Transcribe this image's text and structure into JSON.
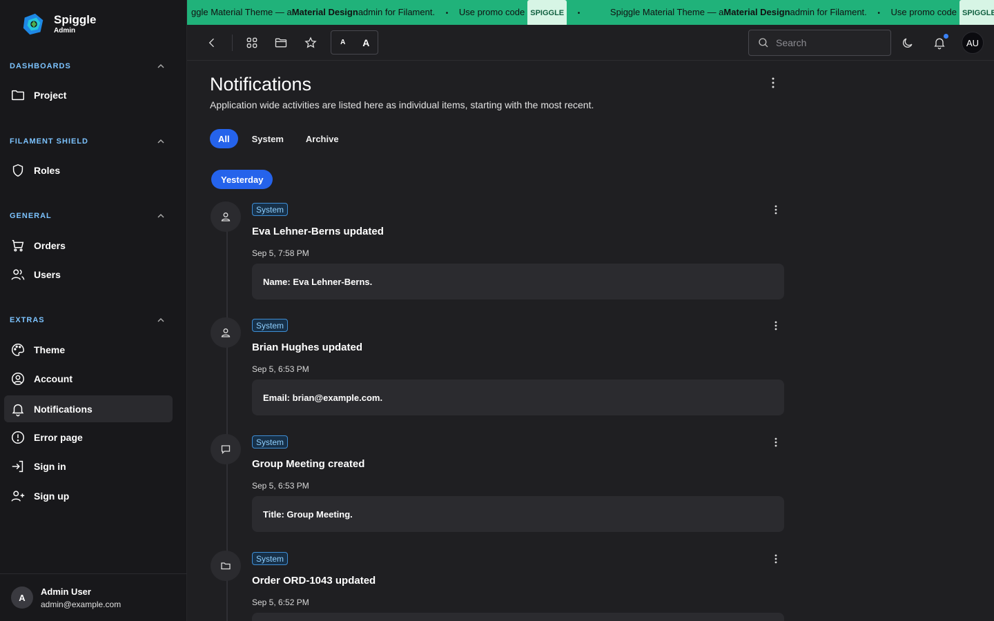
{
  "brand": {
    "name": "Spiggle",
    "sub": "Admin"
  },
  "sidebar": {
    "groups": [
      {
        "label": "DASHBOARDS",
        "items": [
          {
            "label": "Project",
            "icon": "folder-icon"
          }
        ]
      },
      {
        "label": "FILAMENT SHIELD",
        "items": [
          {
            "label": "Roles",
            "icon": "shield-icon"
          }
        ]
      },
      {
        "label": "GENERAL",
        "items": [
          {
            "label": "Orders",
            "icon": "cart-icon"
          },
          {
            "label": "Users",
            "icon": "users-icon"
          }
        ]
      },
      {
        "label": "EXTRAS",
        "items": [
          {
            "label": "Theme",
            "icon": "palette-icon"
          },
          {
            "label": "Account",
            "icon": "user-circle-icon"
          },
          {
            "label": "Notifications",
            "icon": "bell-icon",
            "active": true
          },
          {
            "label": "Error page",
            "icon": "alert-circle-icon"
          },
          {
            "label": "Sign in",
            "icon": "sign-in-icon"
          },
          {
            "label": "Sign up",
            "icon": "user-plus-icon"
          }
        ]
      }
    ],
    "user": {
      "initial": "A",
      "name": "Admin User",
      "email": "admin@example.com"
    }
  },
  "banner": {
    "part1_prefix": "ggle Material Theme — a ",
    "part1_bold": "Material Design",
    "part1_suffix": " admin for Filament.",
    "promo_text": "Use promo code",
    "promo_code": "SPIGGLE",
    "part2_prefix": "Spiggle Material Theme — a ",
    "part2_bold": "Material Design",
    "part2_suffix": " admin for Filament.",
    "promo_code_cut": "SPIGGLE",
    "separator": "•",
    "color": "#20b27a"
  },
  "topbar": {
    "font_small": "A",
    "font_large": "A",
    "search_placeholder": "Search",
    "avatar_initials": "AU",
    "notification_dot_color": "#3b82f6"
  },
  "page": {
    "title": "Notifications",
    "description": "Application wide activities are listed here as individual items, starting with the most recent.",
    "tabs": [
      {
        "label": "All",
        "active": true
      },
      {
        "label": "System"
      },
      {
        "label": "Archive"
      }
    ],
    "date_group": "Yesterday"
  },
  "notifications": [
    {
      "badge": "System",
      "icon": "user-icon",
      "title": "Eva Lehner-Berns updated",
      "time": "Sep 5, 7:58 PM",
      "detail": "Name: Eva Lehner-Berns."
    },
    {
      "badge": "System",
      "icon": "user-icon",
      "title": "Brian Hughes updated",
      "time": "Sep 5, 6:53 PM",
      "detail": "Email: brian@example.com."
    },
    {
      "badge": "System",
      "icon": "chat-icon",
      "title": "Group Meeting created",
      "time": "Sep 5, 6:53 PM",
      "detail": "Title: Group Meeting."
    },
    {
      "badge": "System",
      "icon": "folder-icon",
      "title": "Order ORD-1043 updated",
      "time": "Sep 5, 6:52 PM",
      "detail": ""
    }
  ],
  "accent_color": "#2563eb"
}
